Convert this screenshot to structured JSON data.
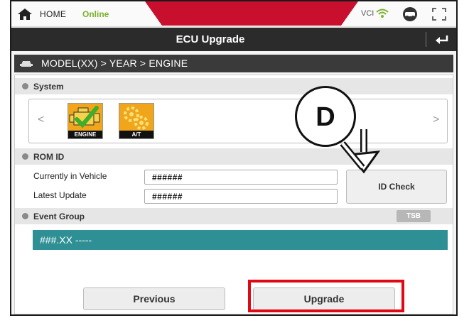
{
  "statusbar": {
    "home_label": "HOME",
    "online_label": "Online",
    "vci_label": "VCI",
    "icons": [
      "home-icon",
      "wifi-icon",
      "vehicle-icon",
      "screen-icon"
    ]
  },
  "titlebar": {
    "title": "ECU Upgrade",
    "back_icon": "back-arrow-icon"
  },
  "breadcrumb": {
    "path": "MODEL(XX) > YEAR > ENGINE",
    "icon": "car-icon"
  },
  "system": {
    "label": "System",
    "tiles": [
      {
        "label": "ENGINE",
        "icon": "engine-check-icon"
      },
      {
        "label": "A/T",
        "icon": "gears-icon"
      }
    ]
  },
  "rom_id": {
    "label": "ROM ID",
    "fields": [
      {
        "label": "Currently in Vehicle",
        "value": "######"
      },
      {
        "label": "Latest Update",
        "value": "######"
      }
    ],
    "id_check_label": "ID Check"
  },
  "event_group": {
    "label": "Event Group",
    "tsb_label": "TSB",
    "items": [
      "###.XX -----"
    ]
  },
  "footer": {
    "previous_label": "Previous",
    "upgrade_label": "Upgrade"
  },
  "annotation": {
    "callout_letter": "D"
  },
  "colors": {
    "brand_red": "#c8102e",
    "online_green": "#7ab32e",
    "event_teal": "#2e8f94",
    "highlight_red": "#e30613"
  }
}
